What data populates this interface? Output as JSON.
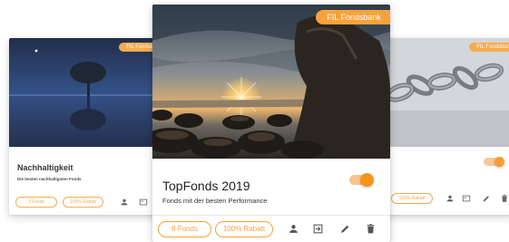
{
  "accent_color": "#f7a23c",
  "cards": [
    {
      "badge": "FIL Fondsbank",
      "title": "Nachhaltigkeit",
      "subtitle": "Die besten nachhaltigsten Fonds",
      "chip_fonds": "3 Fonds",
      "chip_rabatt": "100% Rabatt",
      "icons": [
        "user-icon",
        "card-icon"
      ]
    },
    {
      "badge": "FIL Fondsbank",
      "title": "TopFonds 2019",
      "subtitle": "Fonds mit der besten Performance",
      "toggle_on": true,
      "chip_fonds": "8 Fonds",
      "chip_rabatt": "100% Rabatt",
      "icons": [
        "user-icon",
        "login-icon",
        "edit-icon",
        "trash-icon"
      ]
    },
    {
      "badge": "FIL Fondsbank",
      "title": "",
      "subtitle": "",
      "toggle_on": true,
      "chip_rabatt": "100% Rabatt",
      "icons": [
        "user-icon",
        "card-icon",
        "edit-icon",
        "trash-icon"
      ]
    }
  ]
}
